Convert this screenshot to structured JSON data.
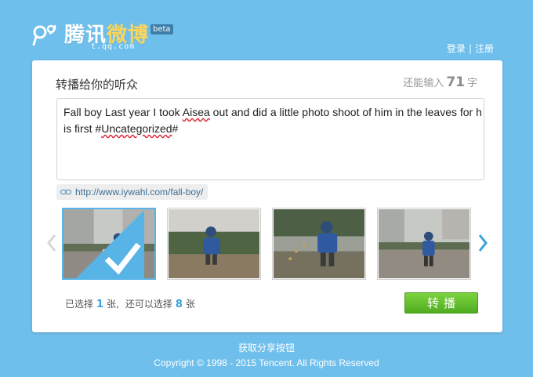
{
  "header": {
    "logo_text_main": "腾讯",
    "logo_text_accent": "微博",
    "logo_sub": "t.qq.com",
    "beta": "beta",
    "login": "登录",
    "separator": "|",
    "register": "注册"
  },
  "share": {
    "title": "转播给你的听众",
    "remain_prefix": "还能输入",
    "remain_count": "71",
    "remain_suffix": "字",
    "text_part1": " Fall boy Last year I took ",
    "text_aisea": "Aisea",
    "text_part2": " out and did a little photo shoot of him in the leaves for his first #",
    "text_uncategorized": "Uncategorized",
    "text_part3": "#",
    "url": "http://www.iywahl.com/fall-boy/"
  },
  "gallery": {
    "selected_index": 0,
    "thumbnails": [
      "photo-1",
      "photo-2",
      "photo-3",
      "photo-4"
    ]
  },
  "selection": {
    "prefix": "已选择",
    "selected_count": "1",
    "unit1": "张,",
    "middle": "还可以选择",
    "remaining_count": "8",
    "unit2": "张"
  },
  "actions": {
    "submit": "转播"
  },
  "footer": {
    "get_button": "获取分享按钮",
    "copyright": "Copyright © 1998 - 2015 Tencent. All Rights Reserved"
  },
  "colors": {
    "background": "#6fbfec",
    "accent_blue": "#58b4e6",
    "submit_green": "#5cb82a"
  },
  "icons": {
    "logo": "tencent-weibo-logo-icon",
    "link": "link-icon",
    "prev": "chevron-left-icon",
    "next": "chevron-right-icon",
    "check": "check-icon"
  }
}
